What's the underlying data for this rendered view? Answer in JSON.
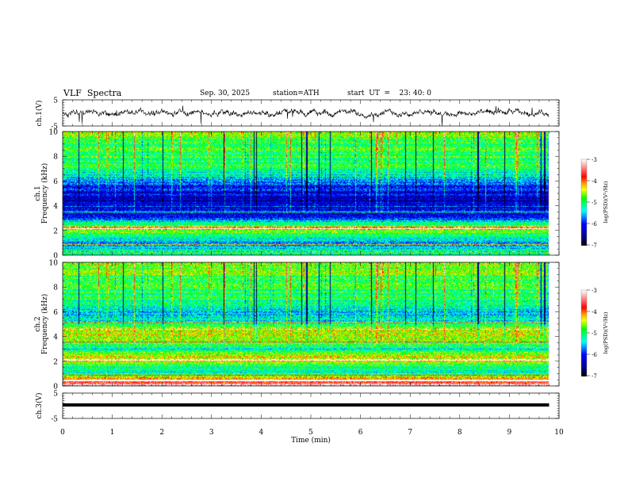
{
  "header": {
    "title": "VLF  Spectra",
    "date": "Sep. 30, 2025",
    "station": "station=ATH",
    "start_ut": "start  UT  =    23: 40: 0"
  },
  "chart_data": [
    {
      "type": "line",
      "name": "ch1",
      "ylabel": "ch.1(V)",
      "ylim": [
        -5,
        5
      ],
      "yticks": [
        "5",
        "-5"
      ],
      "xlim": [
        0,
        10
      ],
      "description_values": "noisy waveform around 0 V, spikes up to about ±4 V, data to ~9.8 min"
    },
    {
      "type": "heatmap",
      "name": "ch1-spectrogram",
      "ylabel": "ch.1\nFrequency (kHz)",
      "ylabel_lines": [
        "ch.1",
        "Frequency (kHz)"
      ],
      "ylim": [
        0,
        10
      ],
      "yticks": [
        "0",
        "2",
        "4",
        "6",
        "8",
        "10"
      ],
      "xlim": [
        0,
        10
      ],
      "colorbar": {
        "label": "log(PSD)(V²/Hz)",
        "range": [
          -7,
          -3
        ],
        "ticks": [
          "-3",
          "-4",
          "-5",
          "-6",
          "-7"
        ]
      },
      "profile_khz_logpsd": [
        [
          0.3,
          -5.2
        ],
        [
          1,
          -5.6
        ],
        [
          1.5,
          -5.4
        ],
        [
          2.2,
          -4.2
        ],
        [
          3,
          -5.9
        ],
        [
          4.5,
          -6.4
        ],
        [
          5.5,
          -6.0
        ],
        [
          7,
          -5.0
        ],
        [
          9,
          -4.8
        ],
        [
          10,
          -4.6
        ]
      ]
    },
    {
      "type": "heatmap",
      "name": "ch2-spectrogram",
      "ylabel_lines": [
        "ch.2",
        "Frequency (kHz)"
      ],
      "ylim": [
        0,
        10
      ],
      "yticks": [
        "0",
        "2",
        "4",
        "6",
        "8",
        "10"
      ],
      "xlim": [
        0,
        10
      ],
      "colorbar": {
        "label": "log(PSD)(V²/Hz)",
        "range": [
          -7,
          -3
        ],
        "ticks": [
          "-3",
          "-4",
          "-5",
          "-6",
          "-7"
        ]
      },
      "profile_khz_logpsd": [
        [
          0.5,
          -4.0
        ],
        [
          1.2,
          -5.3
        ],
        [
          2.2,
          -4.3
        ],
        [
          3,
          -5.2
        ],
        [
          3.6,
          -4.6
        ],
        [
          4.6,
          -4.5
        ],
        [
          5.5,
          -5.5
        ],
        [
          7,
          -5.0
        ],
        [
          9,
          -4.8
        ],
        [
          10,
          -4.6
        ]
      ]
    },
    {
      "type": "line",
      "name": "ch3",
      "ylabel": "ch.3(V)",
      "ylim": [
        -5,
        5
      ],
      "yticks": [
        "5",
        "-5"
      ],
      "xlim": [
        0,
        10
      ],
      "description_values": "flat thick trace near 0 V"
    }
  ],
  "xaxis": {
    "label": "Time  (min)",
    "ticks": [
      "0",
      "1",
      "2",
      "3",
      "4",
      "5",
      "6",
      "7",
      "8",
      "9",
      "10"
    ]
  }
}
